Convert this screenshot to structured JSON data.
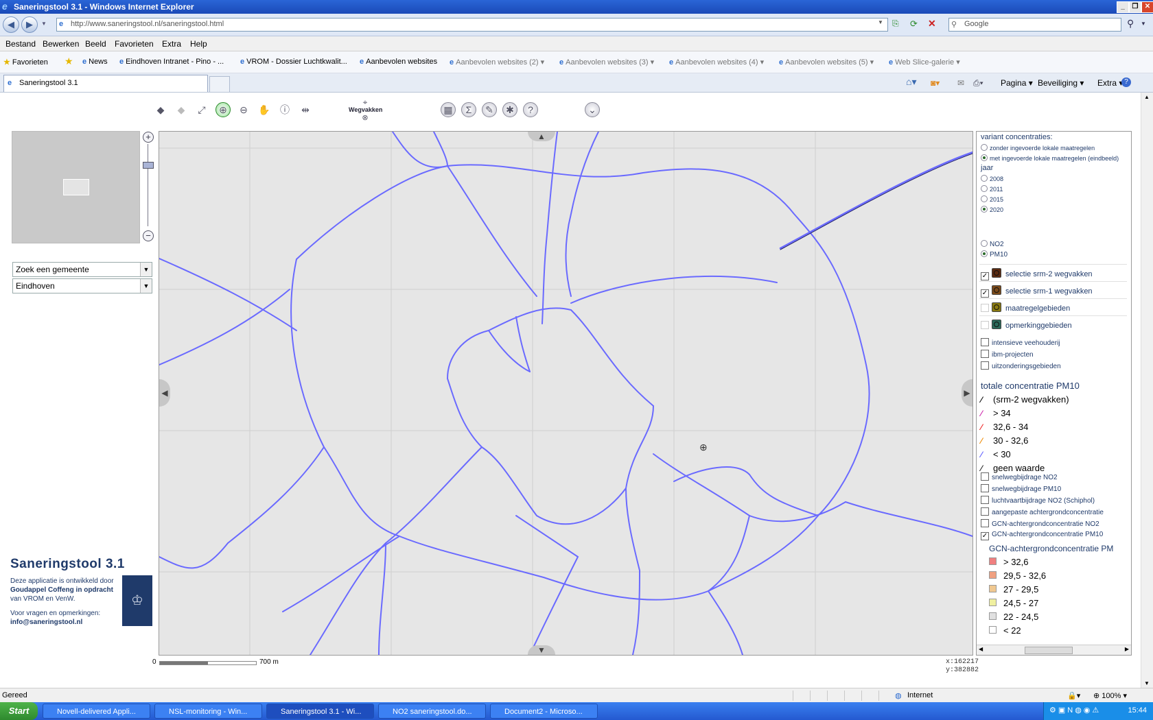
{
  "window": {
    "title": "Saneringstool 3.1 - Windows Internet Explorer"
  },
  "address": {
    "url": "http://www.saneringstool.nl/saneringstool.html",
    "search_placeholder": "Google"
  },
  "menubar": [
    "Bestand",
    "Bewerken",
    "Beeld",
    "Favorieten",
    "Extra",
    "Help"
  ],
  "favorites": {
    "label": "Favorieten",
    "items": [
      "News",
      "Eindhoven Intranet - Pino - ...",
      "VROM - Dossier Luchtkwalit...",
      "Aanbevolen websites",
      "Aanbevolen websites (2)",
      "Aanbevolen websites (3)",
      "Aanbevolen websites (4)",
      "Aanbevolen websites (5)",
      "Web Slice-galerie"
    ]
  },
  "tab": {
    "title": "Saneringstool 3.1"
  },
  "toolbar_right": {
    "pagina": "Pagina",
    "beveiliging": "Beveiliging",
    "extra": "Extra"
  },
  "app": {
    "wegvakken_label": "Wegvakken",
    "municipality_combo": "Zoek een gemeente",
    "city_combo": "Eindhoven",
    "logo": {
      "title": "Saneringstool 3.1",
      "line1": "Deze applicatie is ontwikkeld door",
      "line2": "Goudappel Coffeng in opdracht",
      "line3": "van VROM en VenW.",
      "line4": "Voor vragen en opmerkingen:",
      "line5": "info@saneringstool.nl"
    },
    "scale": {
      "start": "0",
      "end": "700 m"
    },
    "coords": {
      "x": "x:162217",
      "y": "y:382882"
    }
  },
  "legend": {
    "variant_title": "variant concentraties:",
    "variant_options": [
      "zonder ingevoerde lokale maatregelen",
      "met ingevoerde lokale maatregelen (eindbeeld)"
    ],
    "variant_selected": 1,
    "jaar_title": "jaar",
    "years": [
      "2008",
      "2011",
      "2015",
      "2020"
    ],
    "year_selected": 3,
    "substances": [
      "NO2",
      "PM10"
    ],
    "substance_selected": 1,
    "layers": [
      {
        "label": "selectie srm-2 wegvakken",
        "checked": true,
        "color": "#5a2a10"
      },
      {
        "label": "selectie srm-1 wegvakken",
        "checked": true,
        "color": "#7a4a1a"
      },
      {
        "label": "maatregelgebieden",
        "checked": false,
        "color": "#8a7a10"
      },
      {
        "label": "opmerkinggebieden",
        "checked": false,
        "color": "#2a6a5a"
      }
    ],
    "extra_layers": [
      "intensieve veehouderij",
      "ibm-projecten",
      "uitzonderingsgebieden"
    ],
    "conc_title": "totale concentratie PM10",
    "conc_items": [
      {
        "label": "(srm-2 wegvakken)",
        "color": "#000000"
      },
      {
        "label": "> 34",
        "color": "#cc22aa"
      },
      {
        "label": "32,6 - 34",
        "color": "#ee2222"
      },
      {
        "label": "30 - 32,6",
        "color": "#ee8800"
      },
      {
        "label": "< 30",
        "color": "#5b5bff"
      },
      {
        "label": "geen waarde",
        "color": "#222222"
      }
    ],
    "bg_layers": [
      {
        "label": "snelwegbijdrage NO2",
        "checked": false
      },
      {
        "label": "snelwegbijdrage PM10",
        "checked": false
      },
      {
        "label": "luchtvaartbijdrage NO2 (Schiphol)",
        "checked": false
      },
      {
        "label": "aangepaste achtergrondconcentratie",
        "checked": false
      },
      {
        "label": "GCN-achtergrondconcentratie NO2",
        "checked": false
      },
      {
        "label": "GCN-achtergrondconcentratie PM10",
        "checked": true
      }
    ],
    "gcn_title": "GCN-achtergrondconcentratie PM",
    "gcn_items": [
      {
        "label": "> 32,6",
        "color": "#f08080"
      },
      {
        "label": "29,5 - 32,6",
        "color": "#f0a080"
      },
      {
        "label": "27 - 29,5",
        "color": "#f0c890"
      },
      {
        "label": "24,5 - 27",
        "color": "#f0f0a0"
      },
      {
        "label": "22 - 24,5",
        "color": "#e0e0e0"
      },
      {
        "label": "< 22",
        "color": "#ffffff"
      }
    ]
  },
  "statusbar": {
    "left": "Gereed",
    "zone": "Internet",
    "zoom": "100%"
  },
  "taskbar": {
    "start": "Start",
    "tasks": [
      "Novell-delivered Appli...",
      "NSL-monitoring - Win...",
      "Saneringstool 3.1 - Wi...",
      "NO2 saneringstool.do...",
      "Document2 - Microso..."
    ],
    "active": 2,
    "clock": "15:44"
  },
  "colors": {
    "road": "#6a6aff",
    "map_bg": "#e6e6e6",
    "brand": "#1f3a6a"
  }
}
